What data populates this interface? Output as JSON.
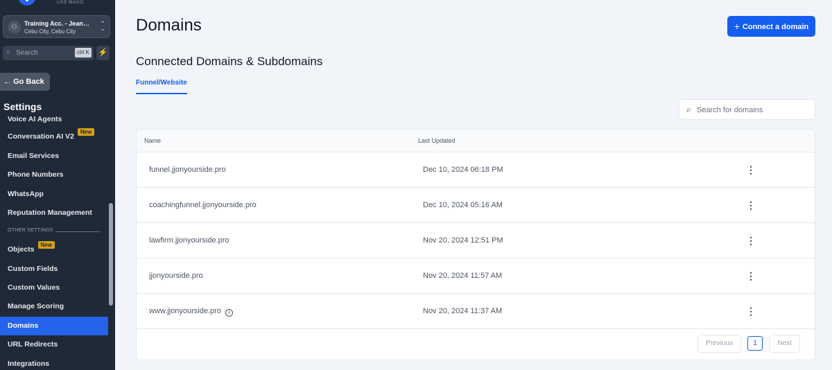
{
  "brand": {
    "tagline": "LIKE MAGIC"
  },
  "account": {
    "name": "Training Acc. - Jean…",
    "location": "Cebu City, Cebu City"
  },
  "sidebar_search": {
    "placeholder": "Search",
    "shortcut": "ctrl K"
  },
  "go_back": "Go Back",
  "settings_title": "Settings",
  "nav": {
    "items_top": [
      {
        "label": "Voice AI Agents"
      },
      {
        "label": "Conversation AI V2",
        "badge": "New"
      },
      {
        "label": "Email Services"
      },
      {
        "label": "Phone Numbers"
      },
      {
        "label": "WhatsApp"
      },
      {
        "label": "Reputation Management"
      }
    ],
    "section_label": "OTHER SETTINGS",
    "items_bottom": [
      {
        "label": "Objects",
        "badge": "New"
      },
      {
        "label": "Custom Fields"
      },
      {
        "label": "Custom Values"
      },
      {
        "label": "Manage Scoring"
      },
      {
        "label": "Domains",
        "active": true
      },
      {
        "label": "URL Redirects"
      },
      {
        "label": "Integrations"
      }
    ]
  },
  "main": {
    "title": "Domains",
    "connect_button": "Connect a domain",
    "subtitle": "Connected Domains & Subdomains",
    "tab": "Funnel/Website",
    "search_placeholder": "Search for domains",
    "table": {
      "headers": [
        "Name",
        "Last Updated"
      ],
      "rows": [
        {
          "name": "funnel.jjonyourside.pro",
          "updated": "Dec 10, 2024 06:18 PM"
        },
        {
          "name": "coachingfunnel.jjonyourside.pro",
          "updated": "Dec 10, 2024 05:16 AM"
        },
        {
          "name": "lawfirm.jjonyourside.pro",
          "updated": "Nov 20, 2024 12:51 PM"
        },
        {
          "name": "jjonyourside.pro",
          "updated": "Nov 20, 2024 11:57 AM"
        },
        {
          "name": "www.jjonyourside.pro",
          "updated": "Nov 20, 2024 11:37 AM",
          "info": true
        }
      ]
    },
    "pagination": {
      "previous": "Previous",
      "page": "1",
      "next": "Next"
    }
  },
  "icons": {
    "kebab": "more-vertical-icon",
    "info": "info-icon",
    "bolt": "bolt-icon",
    "accent": "#155eef",
    "active_nav": "#2563eb",
    "badge": "#d4a017"
  }
}
